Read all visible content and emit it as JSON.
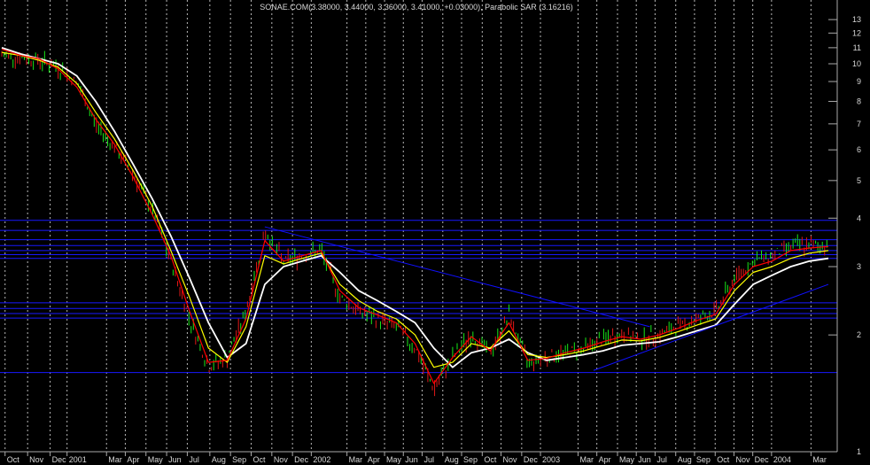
{
  "chart_data": {
    "type": "line",
    "title": "SONAE.COM(3.38000, 3.44000, 3.36000, 3.41000, +0.03000), Parabolic SAR (3.16216)",
    "yscale": "log",
    "ylim": [
      1,
      14
    ],
    "ytick_labels": [
      "13",
      "12",
      "11",
      "10",
      "9",
      "8",
      "7",
      "6",
      "5",
      "4",
      "3",
      "2",
      "1"
    ],
    "yticks": [
      13,
      12,
      11,
      10,
      9,
      8,
      7,
      6,
      5,
      4,
      3,
      2,
      1
    ],
    "x_labels": [
      "Oct",
      "Nov",
      "Dec",
      "2001",
      "Mar",
      "Apr",
      "May",
      "Jun",
      "Jul",
      "Aug",
      "Sep",
      "Oct",
      "Nov",
      "Dec",
      "2002",
      "Mar",
      "Apr",
      "May",
      "Jun",
      "Jul",
      "Aug",
      "Sep",
      "Oct",
      "Nov",
      "Dec",
      "2003",
      "Mar",
      "Apr",
      "May",
      "Jun",
      "Jul",
      "Aug",
      "Sep",
      "Oct",
      "Nov",
      "Dec",
      "2004",
      "Mar"
    ],
    "x_index": [
      0.6,
      1.8,
      3.0,
      3.9,
      6.0,
      7.0,
      8.1,
      9.2,
      10.3,
      11.5,
      12.6,
      13.7,
      14.8,
      15.9,
      16.9,
      18.8,
      19.8,
      20.8,
      21.8,
      22.8,
      23.9,
      24.9,
      26.0,
      27.0,
      28.1,
      29.1,
      31.1,
      32.1,
      33.2,
      34.2,
      35.2,
      36.3,
      37.3,
      38.4,
      39.4,
      40.4,
      41.4,
      43.5
    ],
    "grid": true,
    "horizontal_levels": [
      3.95,
      3.72,
      3.52,
      3.4,
      3.3,
      3.22,
      3.15,
      2.42,
      2.34,
      2.27,
      2.21,
      1.6
    ],
    "price": {
      "x": [
        0,
        1,
        2,
        3,
        4,
        5,
        6,
        7,
        8,
        9,
        10,
        11,
        12,
        13,
        14,
        15,
        16,
        17,
        18,
        19,
        20,
        21,
        22,
        23,
        24,
        25,
        26,
        27,
        28,
        29,
        30,
        31,
        32,
        33,
        34,
        35,
        36,
        37,
        38,
        39,
        40,
        41,
        42,
        43,
        44
      ],
      "values": [
        10.5,
        10.4,
        10.2,
        9.8,
        8.9,
        7.0,
        6.1,
        5.2,
        4.2,
        3.1,
        2.2,
        1.65,
        1.75,
        2.3,
        3.7,
        3.1,
        3.2,
        3.3,
        2.5,
        2.3,
        2.2,
        2.1,
        1.85,
        1.45,
        1.75,
        2.0,
        1.8,
        2.25,
        1.7,
        1.75,
        1.8,
        1.85,
        1.95,
        2.0,
        1.95,
        2.0,
        2.1,
        2.2,
        2.3,
        2.8,
        3.1,
        3.2,
        3.4,
        3.4,
        3.4
      ]
    },
    "series": [
      {
        "color": "#ffffff",
        "values": [
          11.0,
          10.6,
          10.3,
          10.0,
          9.3,
          8.0,
          6.7,
          5.5,
          4.5,
          3.6,
          2.8,
          2.15,
          1.75,
          1.9,
          2.7,
          3.0,
          3.1,
          3.2,
          2.9,
          2.6,
          2.45,
          2.3,
          2.15,
          1.85,
          1.65,
          1.8,
          1.85,
          1.95,
          1.8,
          1.72,
          1.75,
          1.78,
          1.82,
          1.88,
          1.9,
          1.92,
          1.98,
          2.05,
          2.12,
          2.4,
          2.7,
          2.85,
          3.0,
          3.1,
          3.15
        ]
      },
      {
        "color": "#ffff00",
        "values": [
          10.7,
          10.5,
          10.2,
          9.8,
          8.9,
          7.5,
          6.4,
          5.3,
          4.3,
          3.3,
          2.5,
          1.85,
          1.7,
          2.1,
          3.2,
          3.05,
          3.15,
          3.25,
          2.7,
          2.45,
          2.3,
          2.2,
          2.0,
          1.65,
          1.7,
          1.9,
          1.85,
          2.05,
          1.78,
          1.75,
          1.78,
          1.82,
          1.88,
          1.94,
          1.93,
          1.97,
          2.04,
          2.12,
          2.2,
          2.6,
          2.9,
          3.0,
          3.15,
          3.25,
          3.3
        ]
      },
      {
        "color": "#ff0000",
        "values": [
          10.9,
          10.5,
          10.3,
          9.7,
          8.7,
          7.2,
          6.2,
          5.1,
          4.1,
          3.2,
          2.3,
          1.7,
          1.72,
          2.2,
          3.5,
          3.1,
          3.2,
          3.3,
          2.6,
          2.35,
          2.25,
          2.15,
          1.9,
          1.5,
          1.75,
          1.98,
          1.82,
          2.15,
          1.72,
          1.74,
          1.8,
          1.85,
          1.92,
          1.98,
          1.95,
          2.0,
          2.08,
          2.18,
          2.26,
          2.7,
          3.0,
          3.1,
          3.3,
          3.35,
          3.38
        ]
      }
    ],
    "trend_lines": [
      {
        "color": "#1010ff",
        "points": [
          [
            14.0,
            3.8
          ],
          [
            34.5,
            2.1
          ]
        ]
      },
      {
        "color": "#1010ff",
        "points": [
          [
            31.5,
            1.62
          ],
          [
            44.0,
            2.7
          ]
        ]
      }
    ]
  }
}
